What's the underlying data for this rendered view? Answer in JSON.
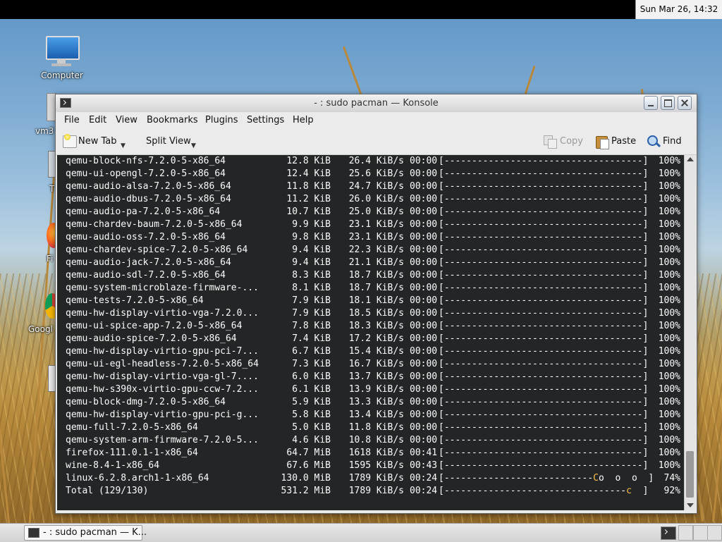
{
  "topbar": {
    "clock": "Sun Mar 26, 14:32"
  },
  "desktop": {
    "icons": [
      {
        "label": "Computer"
      },
      {
        "label": "vm3"
      },
      {
        "label": "T"
      },
      {
        "label": "Fi"
      },
      {
        "label": "Googl"
      }
    ]
  },
  "window": {
    "title": "- : sudo pacman — Konsole",
    "menu": [
      "File",
      "Edit",
      "View",
      "Bookmarks",
      "Plugins",
      "Settings",
      "Help"
    ],
    "toolbar": {
      "new_tab": "New Tab",
      "split_view": "Split View",
      "copy": "Copy",
      "paste": "Paste",
      "find": "Find"
    },
    "terminal": {
      "rows": [
        {
          "name": "qemu-block-nfs-7.2.0-5-x86_64",
          "size": "12.8 KiB",
          "rate": "26.4 KiB/s",
          "eta": "00:00",
          "bar": "[------------------------------------]",
          "pct": "100%"
        },
        {
          "name": "qemu-ui-opengl-7.2.0-5-x86_64",
          "size": "12.4 KiB",
          "rate": "25.6 KiB/s",
          "eta": "00:00",
          "bar": "[------------------------------------]",
          "pct": "100%"
        },
        {
          "name": "qemu-audio-alsa-7.2.0-5-x86_64",
          "size": "11.8 KiB",
          "rate": "24.7 KiB/s",
          "eta": "00:00",
          "bar": "[------------------------------------]",
          "pct": "100%"
        },
        {
          "name": "qemu-audio-dbus-7.2.0-5-x86_64",
          "size": "11.2 KiB",
          "rate": "26.0 KiB/s",
          "eta": "00:00",
          "bar": "[------------------------------------]",
          "pct": "100%"
        },
        {
          "name": "qemu-audio-pa-7.2.0-5-x86_64",
          "size": "10.7 KiB",
          "rate": "25.0 KiB/s",
          "eta": "00:00",
          "bar": "[------------------------------------]",
          "pct": "100%"
        },
        {
          "name": "qemu-chardev-baum-7.2.0-5-x86_64",
          "size": "9.9 KiB",
          "rate": "23.1 KiB/s",
          "eta": "00:00",
          "bar": "[------------------------------------]",
          "pct": "100%"
        },
        {
          "name": "qemu-audio-oss-7.2.0-5-x86_64",
          "size": "9.8 KiB",
          "rate": "23.1 KiB/s",
          "eta": "00:00",
          "bar": "[------------------------------------]",
          "pct": "100%"
        },
        {
          "name": "qemu-chardev-spice-7.2.0-5-x86_64",
          "size": "9.4 KiB",
          "rate": "22.3 KiB/s",
          "eta": "00:00",
          "bar": "[------------------------------------]",
          "pct": "100%"
        },
        {
          "name": "qemu-audio-jack-7.2.0-5-x86_64",
          "size": "9.4 KiB",
          "rate": "21.1 KiB/s",
          "eta": "00:00",
          "bar": "[------------------------------------]",
          "pct": "100%"
        },
        {
          "name": "qemu-audio-sdl-7.2.0-5-x86_64",
          "size": "8.3 KiB",
          "rate": "18.7 KiB/s",
          "eta": "00:00",
          "bar": "[------------------------------------]",
          "pct": "100%"
        },
        {
          "name": "qemu-system-microblaze-firmware-...",
          "size": "8.1 KiB",
          "rate": "18.7 KiB/s",
          "eta": "00:00",
          "bar": "[------------------------------------]",
          "pct": "100%"
        },
        {
          "name": "qemu-tests-7.2.0-5-x86_64",
          "size": "7.9 KiB",
          "rate": "18.1 KiB/s",
          "eta": "00:00",
          "bar": "[------------------------------------]",
          "pct": "100%"
        },
        {
          "name": "qemu-hw-display-virtio-vga-7.2.0...",
          "size": "7.9 KiB",
          "rate": "18.5 KiB/s",
          "eta": "00:00",
          "bar": "[------------------------------------]",
          "pct": "100%"
        },
        {
          "name": "qemu-ui-spice-app-7.2.0-5-x86_64",
          "size": "7.8 KiB",
          "rate": "18.3 KiB/s",
          "eta": "00:00",
          "bar": "[------------------------------------]",
          "pct": "100%"
        },
        {
          "name": "qemu-audio-spice-7.2.0-5-x86_64",
          "size": "7.4 KiB",
          "rate": "17.2 KiB/s",
          "eta": "00:00",
          "bar": "[------------------------------------]",
          "pct": "100%"
        },
        {
          "name": "qemu-hw-display-virtio-gpu-pci-7...",
          "size": "6.7 KiB",
          "rate": "15.4 KiB/s",
          "eta": "00:00",
          "bar": "[------------------------------------]",
          "pct": "100%"
        },
        {
          "name": "qemu-ui-egl-headless-7.2.0-5-x86_64",
          "size": "7.3 KiB",
          "rate": "16.7 KiB/s",
          "eta": "00:00",
          "bar": "[------------------------------------]",
          "pct": "100%"
        },
        {
          "name": "qemu-hw-display-virtio-vga-gl-7....",
          "size": "6.0 KiB",
          "rate": "13.7 KiB/s",
          "eta": "00:00",
          "bar": "[------------------------------------]",
          "pct": "100%"
        },
        {
          "name": "qemu-hw-s390x-virtio-gpu-ccw-7.2...",
          "size": "6.1 KiB",
          "rate": "13.9 KiB/s",
          "eta": "00:00",
          "bar": "[------------------------------------]",
          "pct": "100%"
        },
        {
          "name": "qemu-block-dmg-7.2.0-5-x86_64",
          "size": "5.9 KiB",
          "rate": "13.3 KiB/s",
          "eta": "00:00",
          "bar": "[------------------------------------]",
          "pct": "100%"
        },
        {
          "name": "qemu-hw-display-virtio-gpu-pci-g...",
          "size": "5.8 KiB",
          "rate": "13.4 KiB/s",
          "eta": "00:00",
          "bar": "[------------------------------------]",
          "pct": "100%"
        },
        {
          "name": "qemu-full-7.2.0-5-x86_64",
          "size": "5.0 KiB",
          "rate": "11.8 KiB/s",
          "eta": "00:00",
          "bar": "[------------------------------------]",
          "pct": "100%"
        },
        {
          "name": "qemu-system-arm-firmware-7.2.0-5...",
          "size": "4.6 KiB",
          "rate": "10.8 KiB/s",
          "eta": "00:00",
          "bar": "[------------------------------------]",
          "pct": "100%"
        },
        {
          "name": "firefox-111.0.1-1-x86_64",
          "size": "64.7 MiB",
          "rate": "1618 KiB/s",
          "eta": "00:41",
          "bar": "[------------------------------------]",
          "pct": "100%"
        },
        {
          "name": "wine-8.4-1-x86_64",
          "size": "67.6 MiB",
          "rate": "1595 KiB/s",
          "eta": "00:43",
          "bar": "[------------------------------------]",
          "pct": "100%"
        },
        {
          "name": "linux-6.2.8.arch1-1-x86_64",
          "size": "130.0 MiB",
          "rate": "1789 KiB/s",
          "eta": "00:24",
          "bar_done": "[---------------------------",
          "bar_pac": "C",
          "bar_rest": "o  o  o  ]",
          "pct": "74%"
        },
        {
          "name": "Total (129/130)",
          "size": "531.2 MiB",
          "rate": "1789 KiB/s",
          "eta": "00:24",
          "bar_done": "[---------------------------------",
          "bar_pac": "c",
          "bar_rest": "  ]",
          "pct": "92%"
        }
      ]
    }
  },
  "panel": {
    "task_label": "- : sudo pacman — K..."
  },
  "colors": {
    "terminal_bg": "#232627",
    "terminal_fg": "#fcfcfc",
    "pacman": "#fdbc4b"
  }
}
